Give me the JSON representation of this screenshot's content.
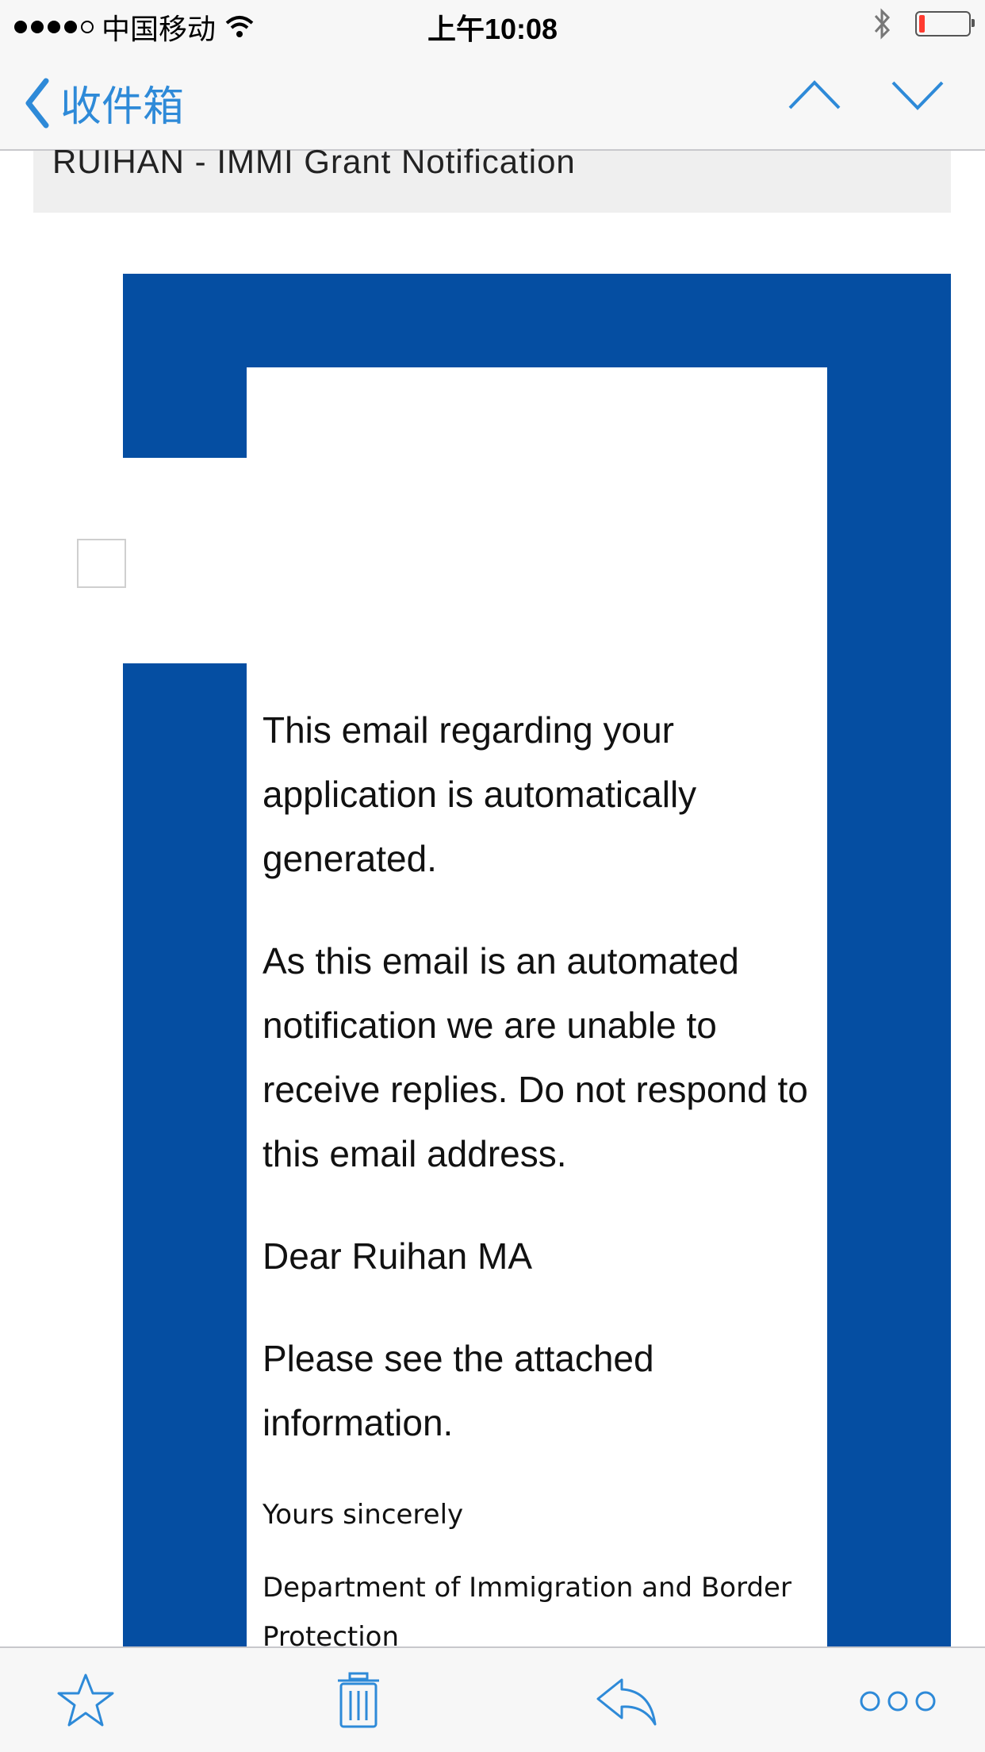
{
  "status_bar": {
    "carrier": "中国移动",
    "time": "上午10:08",
    "signal_bars_filled": 4,
    "signal_bars_total": 5,
    "battery_level": 0.12
  },
  "nav": {
    "back_label": "收件箱",
    "prev_icon": "chevron-up-icon",
    "next_icon": "chevron-down-icon"
  },
  "email": {
    "subject": "RUIHAN - IMMI Grant Notification",
    "paragraphs": [
      "This email regarding your application is automatically generated.",
      "As this email is an automated notification we are unable to receive replies. Do not respond to this email address.",
      "Dear Ruihan MA",
      "Please see the attached information."
    ],
    "closing": "Yours sincerely",
    "sender": "Department of Immigration and Border Protection"
  },
  "toolbar": {
    "icons": [
      "star-icon",
      "trash-icon",
      "reply-icon",
      "more-icon"
    ]
  },
  "colors": {
    "accent": "#2e8ad8",
    "banner_blue": "#054ea2",
    "battery_low": "#ff3b30"
  }
}
